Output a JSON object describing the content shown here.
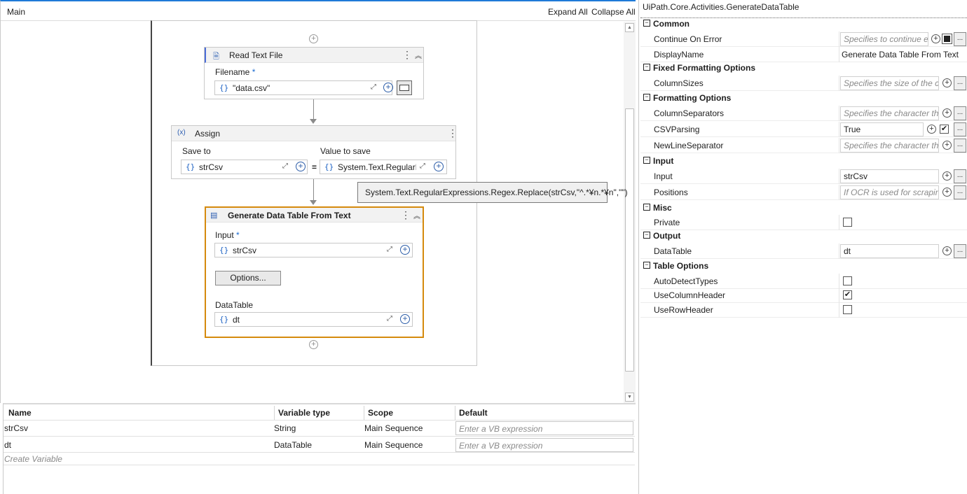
{
  "designer": {
    "breadcrumb": "Main",
    "expand_all": "Expand All",
    "collapse_all": "Collapse All"
  },
  "read_text_file": {
    "title": "Read Text File",
    "field_label": "Filename",
    "required_mark": "*",
    "value": "\"data.csv\""
  },
  "assign": {
    "icon": "(x)",
    "title": "Assign",
    "save_to_label": "Save to",
    "save_to_value": "strCsv",
    "equals": "=",
    "value_to_save_label": "Value to save",
    "value_to_save_value": "System.Text.RegularEx"
  },
  "tooltip": {
    "text": "System.Text.RegularExpressions.Regex.Replace(strCsv,\"^.*¥n.*¥n\",\"\")"
  },
  "generate_dt": {
    "title": "Generate Data Table From Text",
    "input_label": "Input",
    "required_mark": "*",
    "input_value": "strCsv",
    "options_label": "Options...",
    "datatable_label": "DataTable",
    "datatable_value": "dt"
  },
  "variables": {
    "headers": {
      "name": "Name",
      "type": "Variable type",
      "scope": "Scope",
      "default": "Default"
    },
    "rows": [
      {
        "name": "strCsv",
        "type": "String",
        "scope": "Main Sequence",
        "default": "Enter a VB expression"
      },
      {
        "name": "dt",
        "type": "DataTable",
        "scope": "Main Sequence",
        "default": "Enter a VB expression"
      }
    ],
    "create": "Create Variable"
  },
  "properties": {
    "title": "UiPath.Core.Activities.GenerateDataTable",
    "toggle_symbol": "⊟",
    "categories": {
      "common": "Common",
      "fixed": "Fixed Formatting Options",
      "formatting": "Formatting Options",
      "input": "Input",
      "misc": "Misc",
      "output": "Output",
      "table": "Table Options"
    },
    "rows": {
      "continue_on_error": {
        "name": "Continue On Error",
        "placeholder": "Specifies to continue e"
      },
      "display_name": {
        "name": "DisplayName",
        "value": "Generate Data Table From Text"
      },
      "column_sizes": {
        "name": "ColumnSizes",
        "placeholder": "Specifies the size of the cc"
      },
      "column_separators": {
        "name": "ColumnSeparators",
        "placeholder": "Specifies the character tha"
      },
      "csv_parsing": {
        "name": "CSVParsing",
        "value": "True",
        "checked": true
      },
      "newline_separator": {
        "name": "NewLineSeparator",
        "placeholder": "Specifies the character tha"
      },
      "input": {
        "name": "Input",
        "value": "strCsv"
      },
      "positions": {
        "name": "Positions",
        "placeholder": "If OCR is used for scraping"
      },
      "private": {
        "name": "Private",
        "checked": false
      },
      "datatable": {
        "name": "DataTable",
        "value": "dt"
      },
      "auto_detect_types": {
        "name": "AutoDetectTypes",
        "checked": false
      },
      "use_column_header": {
        "name": "UseColumnHeader",
        "checked": true
      },
      "use_row_header": {
        "name": "UseRowHeader",
        "checked": false
      }
    },
    "more_label": "...",
    "check_mark": "✔"
  },
  "colors": {
    "selected_border": "#d58a0d",
    "accent": "#1f7ad8"
  }
}
